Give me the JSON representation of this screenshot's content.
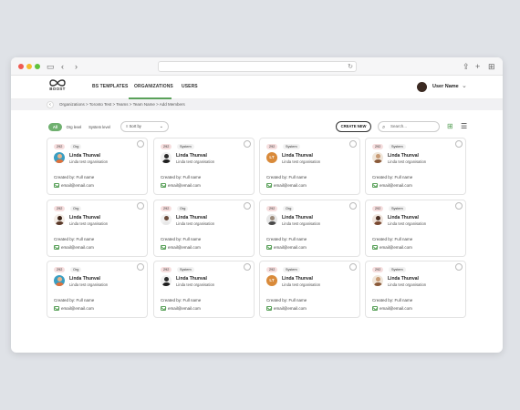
{
  "browser": {
    "reload_icon": "reload-icon"
  },
  "nav": {
    "logo_text": "BOOST",
    "links": [
      "BS TEMPLATES",
      "ORGANIZATIONS",
      "USERS"
    ],
    "active": "ORGANIZATIONS",
    "user_name": "User Name"
  },
  "breadcrumb": {
    "text": "Organizations  >  Toronto Test  >  Teams  >  Team Name  >  Add Members"
  },
  "toolbar": {
    "filters": [
      "All",
      "Org level",
      "System level"
    ],
    "active_filter": "All",
    "sort_label": "Sort by",
    "create_label": "CREATE NEW",
    "search_placeholder": "Search..."
  },
  "cards": [
    {
      "id": "292",
      "type": "Org",
      "name": "Linda Thunval",
      "org": "Linda test organisation",
      "created": "Created by: Full name",
      "email": "email@email.com",
      "avatar": "teal"
    },
    {
      "id": "292",
      "type": "System",
      "name": "Linda Thunval",
      "org": "Linda test organisation",
      "created": "Created by: Full name",
      "email": "email@email.com",
      "avatar": "dark"
    },
    {
      "id": "292",
      "type": "System",
      "name": "Linda Thunval",
      "org": "Linda test organisation",
      "created": "Created by: Full name",
      "email": "email@email.com",
      "avatar": "initials",
      "initials": "LT"
    },
    {
      "id": "292",
      "type": "System",
      "name": "Linda Thunval",
      "org": "Linda test organisation",
      "created": "Created by: Full name",
      "email": "email@email.com",
      "avatar": "beard"
    },
    {
      "id": "292",
      "type": "Org",
      "name": "Linda Thunval",
      "org": "Linda test organisation",
      "created": "Created by: Full name",
      "email": "email@email.com",
      "avatar": "woman"
    },
    {
      "id": "292",
      "type": "Org",
      "name": "Linda Thunval",
      "org": "Linda test organisation",
      "created": "Created by: Full name",
      "email": "email@email.com",
      "avatar": "man-white"
    },
    {
      "id": "292",
      "type": "Org",
      "name": "Linda Thunval",
      "org": "Linda test organisation",
      "created": "Created by: Full name",
      "email": "email@email.com",
      "avatar": "grey"
    },
    {
      "id": "292",
      "type": "System",
      "name": "Linda Thunval",
      "org": "Linda test organisation",
      "created": "Created by: Full name",
      "email": "email@email.com",
      "avatar": "brown"
    },
    {
      "id": "292",
      "type": "Org",
      "name": "Linda Thunval",
      "org": "Linda test organisation",
      "created": "Created by: Full name",
      "email": "email@email.com",
      "avatar": "teal"
    },
    {
      "id": "292",
      "type": "System",
      "name": "Linda Thunval",
      "org": "Linda test organisation",
      "created": "Created by: Full name",
      "email": "email@email.com",
      "avatar": "dark"
    },
    {
      "id": "292",
      "type": "System",
      "name": "Linda Thunval",
      "org": "Linda test organisation",
      "created": "Created by: Full name",
      "email": "email@email.com",
      "avatar": "initials",
      "initials": "LT"
    },
    {
      "id": "292",
      "type": "System",
      "name": "Linda Thunval",
      "org": "Linda test organisation",
      "created": "Created by: Full name",
      "email": "email@email.com",
      "avatar": "beard"
    }
  ],
  "colors": {
    "accent": "#5aa15a",
    "tag_id": "#f6dede",
    "initials_avatar": "#d98a3a"
  }
}
